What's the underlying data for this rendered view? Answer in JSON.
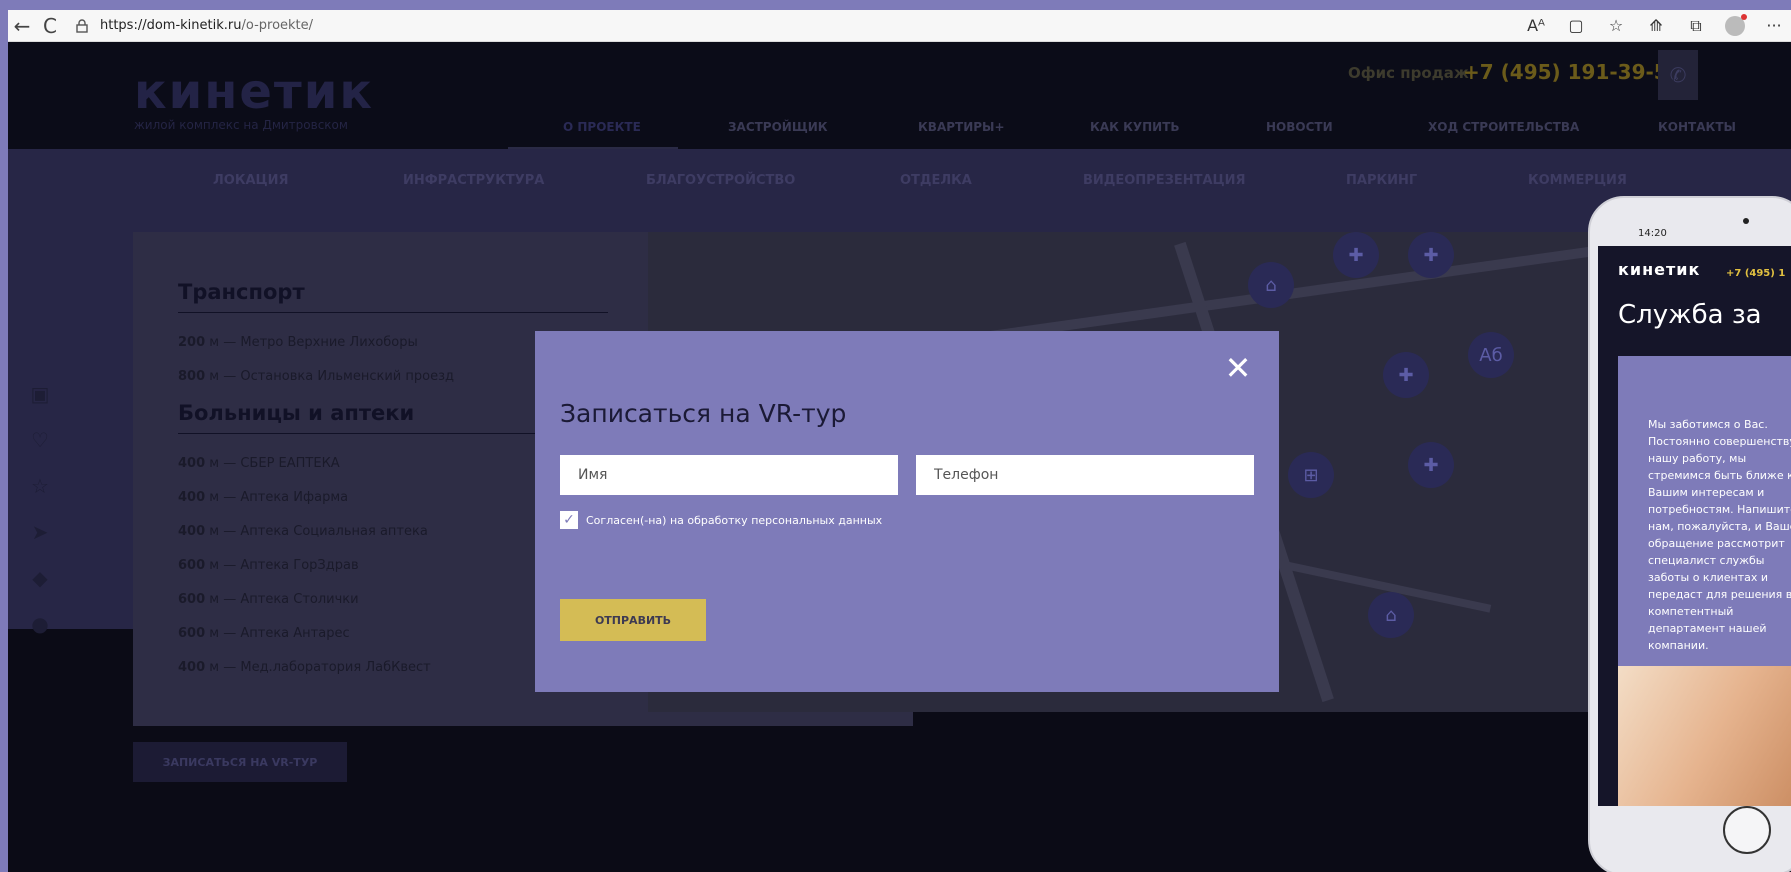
{
  "browser": {
    "url_host": "https://dom-kinetik.ru",
    "url_path": "/o-proekte/",
    "back_icon": "←",
    "reload_icon": "C",
    "icons": [
      "Aᴬ",
      "▢",
      "☆",
      "⟰",
      "⧉",
      "···"
    ]
  },
  "site": {
    "logo": "кинетик",
    "logo_tagline": "жилой комплекс на Дмитровском",
    "office_label": "Офис продаж",
    "phone": "+7 (495) 191-39-58",
    "main_nav": [
      {
        "label": "О ПРОЕКТЕ"
      },
      {
        "label": "ЗАСТРОЙЩИК"
      },
      {
        "label": "КВАРТИРЫ+"
      },
      {
        "label": "КАК КУПИТЬ"
      },
      {
        "label": "НОВОСТИ"
      },
      {
        "label": "ХОД СТРОИТЕЛЬСТВА"
      },
      {
        "label": "КОНТАКТЫ"
      }
    ],
    "sub_nav": [
      {
        "label": "ЛОКАЦИЯ"
      },
      {
        "label": "ИНФРАСТРУКТУРА"
      },
      {
        "label": "БЛАГОУСТРОЙСТВО"
      },
      {
        "label": "ОТДЕЛКА"
      },
      {
        "label": "ВИДЕОПРЕЗЕНТАЦИЯ"
      },
      {
        "label": "ПАРКИНГ"
      },
      {
        "label": "КОММЕРЦИЯ"
      }
    ],
    "sections": {
      "transport": {
        "title": "Транспорт",
        "items": [
          {
            "dist": "200",
            "text": "м — Метро Верхние Лихоборы"
          },
          {
            "dist": "800",
            "text": "м — Остановка Ильменский проезд"
          }
        ]
      },
      "hospitals": {
        "title": "Больницы и аптеки",
        "items": [
          {
            "dist": "400",
            "text": "м — СБЕР ЕАПТЕКА"
          },
          {
            "dist": "400",
            "text": "м — Аптека Ифарма"
          },
          {
            "dist": "400",
            "text": "м — Аптека Социальная аптека"
          },
          {
            "dist": "600",
            "text": "м — Аптека ГорЗдрав"
          },
          {
            "dist": "600",
            "text": "м — Аптека Столички"
          },
          {
            "dist": "600",
            "text": "м — Аптека Антарес"
          },
          {
            "dist": "400",
            "text": "м — Мед.лаборатория ЛабКвест"
          }
        ]
      }
    },
    "vr_button": "ЗАПИСАТЬСЯ НА VR-ТУР"
  },
  "modal": {
    "title": "Записаться на VR-тур",
    "name_placeholder": "Имя",
    "phone_placeholder": "Телефон",
    "consent": "Согласен(-на) на обработку персональных данных",
    "submit": "ОТПРАВИТЬ",
    "close": "✕"
  },
  "phone_mock": {
    "status": "14:20",
    "logo": "кинетик",
    "phone": "+7 (495) 1",
    "title": "Служба за",
    "text": "Мы заботимся о Вас. Постоянно совершенствуя нашу работу, мы стремимся быть ближе к Вашим интересам и потребностям. Напишите нам, пожалуйста, и Ваше обращение рассмотрит специалист службы заботы о клиентах и передаст для решения в компетентный департамент нашей компании."
  },
  "colors": {
    "accent": "#7e7bb9",
    "button_gold": "#d4bc55",
    "dark_bg": "#0b0b16"
  }
}
